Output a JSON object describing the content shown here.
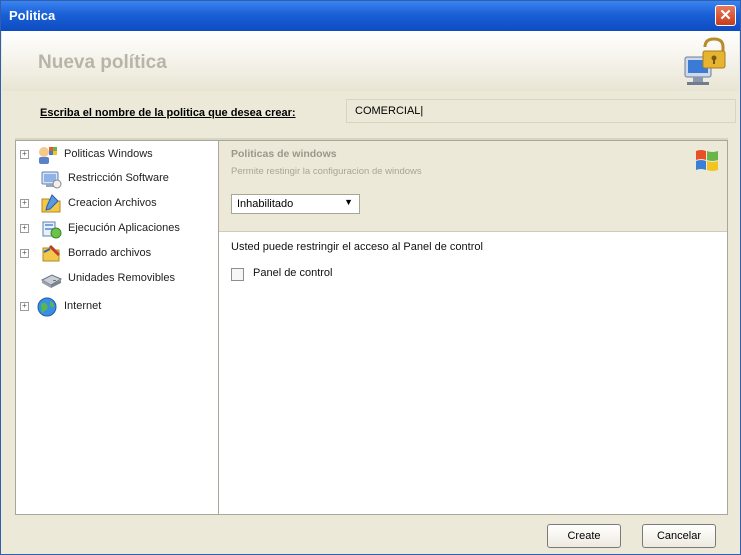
{
  "window": {
    "title": "Politica"
  },
  "header": {
    "title": "Nueva política"
  },
  "name_row": {
    "label": "Escriba el nombre de la politica que desea crear:",
    "value": "COMERCIAL|"
  },
  "sidebar": {
    "items": [
      {
        "label": "Politicas Windows",
        "icon": "windows-flag-icon",
        "expandable": true
      },
      {
        "label": "Restricción Software",
        "icon": "software-restriction-icon",
        "expandable": false
      },
      {
        "label": "Creacion Archivos",
        "icon": "create-files-icon",
        "expandable": true
      },
      {
        "label": "Ejecución Aplicaciones",
        "icon": "run-applications-icon",
        "expandable": true
      },
      {
        "label": "Borrado archivos",
        "icon": "delete-files-icon",
        "expandable": true
      },
      {
        "label": "Unidades Removibles",
        "icon": "removable-drive-icon",
        "expandable": false
      },
      {
        "label": "Internet",
        "icon": "globe-icon",
        "expandable": true
      }
    ]
  },
  "content": {
    "title": "Politicas de windows",
    "subtitle": "Permite restingir la configuracion de windows",
    "select_value": "Inhabilitado",
    "description": "Usted puede restringir el acceso al Panel de control",
    "checkbox_label": "Panel de control",
    "checkbox_checked": false
  },
  "footer": {
    "create_label": "Create",
    "cancel_label": "Cancelar"
  },
  "colors": {
    "titlebar": "#1a5fd6",
    "panel": "#ece9d8",
    "accent": "#2f5fae"
  }
}
